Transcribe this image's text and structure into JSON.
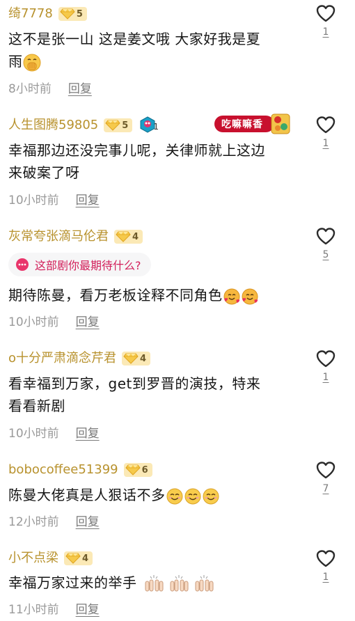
{
  "comments": [
    {
      "username": "绮7778",
      "level": "5",
      "text_line1": "这不是张一山  这是姜文哦  大家好我是夏",
      "text_line2": "雨",
      "emoji": "face-with-hand-over-mouth",
      "time": "8小时前",
      "reply": "回复",
      "likes": "1"
    },
    {
      "username": "人生图腾59805",
      "level": "5",
      "fan_icon_count": "1",
      "sticker_text": "吃嘛嘛香",
      "text_line1": "幸福那边还没完事儿呢，关律师就上这边",
      "text_line2": "来破案了呀",
      "time": "10小时前",
      "reply": "回复",
      "likes": "1"
    },
    {
      "username": "灰常夸张滴马伦君",
      "level": "4",
      "prompt": "这部剧你最期待什么?",
      "text_line1": "期待陈曼，看万老板诠释不同角色",
      "emoji": "smiling-face-with-hearts",
      "time": "10小时前",
      "reply": "回复",
      "likes": "5"
    },
    {
      "username": "o十分严肃滴念芹君",
      "level": "4",
      "text_line1": "看幸福到万家，get到罗晋的演技，特来",
      "text_line2": "看看新剧",
      "time": "10小时前",
      "reply": "回复",
      "likes": "1"
    },
    {
      "username": "bobocoffee51399",
      "level": "6",
      "text_line1": "陈曼大佬真是人狠话不多",
      "emoji": "smiling-face",
      "time": "12小时前",
      "reply": "回复",
      "likes": "7"
    },
    {
      "username": "小不点梁",
      "level": "4",
      "text_line1": "幸福万家过来的举手",
      "emoji": "raising-hands",
      "time": "11小时前",
      "reply": "回复",
      "likes": "1"
    }
  ],
  "colors": {
    "username": "#b8922e",
    "text": "#161616",
    "meta": "#9a9a9a",
    "prompt": "#d21f5a",
    "badge_bg": "#fbe9b6"
  }
}
